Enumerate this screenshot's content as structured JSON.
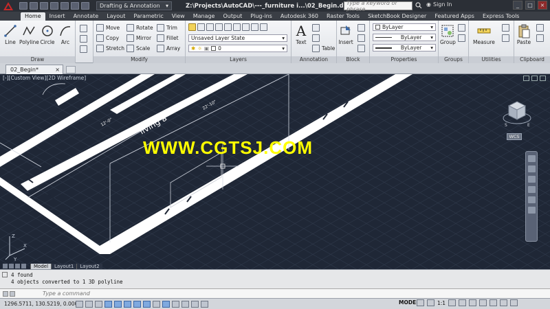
{
  "title_bar": {
    "workspace": "Drafting & Annotation",
    "document_path": "Z:\\Projects\\AutoCAD\\---_furniture i...\\02_Begin.dwg",
    "search_placeholder": "Type a keyword or phrase",
    "sign_in": "Sign In"
  },
  "ribbon_tabs": [
    "Home",
    "Insert",
    "Annotate",
    "Layout",
    "Parametric",
    "View",
    "Manage",
    "Output",
    "Plug-ins",
    "Autodesk 360",
    "Raster Tools",
    "SketchBook Designer",
    "Featured Apps",
    "Express Tools"
  ],
  "ribbon": {
    "draw": {
      "title": "Draw",
      "line": "Line",
      "polyline": "Polyline",
      "circle": "Circle",
      "arc": "Arc"
    },
    "modify": {
      "title": "Modify",
      "move": "Move",
      "rotate": "Rotate",
      "trim": "Trim",
      "copy": "Copy",
      "mirror": "Mirror",
      "fillet": "Fillet",
      "stretch": "Stretch",
      "scale": "Scale",
      "array": "Array"
    },
    "layers": {
      "title": "Layers",
      "layer_state": "Unsaved Layer State",
      "current_layer": "0"
    },
    "annotation": {
      "title": "Annotation",
      "text": "Text",
      "table": "Table"
    },
    "block": {
      "title": "Block",
      "insert": "Insert"
    },
    "properties": {
      "title": "Properties",
      "color": "ByLayer",
      "linetype": "ByLayer",
      "lineweight": "ByLayer"
    },
    "groups": {
      "title": "Groups",
      "group": "Group"
    },
    "utilities": {
      "title": "Utilities",
      "measure": "Measure"
    },
    "clipboard": {
      "title": "Clipboard",
      "paste": "Paste"
    }
  },
  "file_tab": "02_Begin*",
  "viewport": {
    "label": "[-][Custom View][2D Wireframe]",
    "watermark": "WWW.CGTSJ.COM",
    "room_label": "living a",
    "viewcube_wcs": "WCS",
    "viewcube_south": "S",
    "viewcube_east": "E"
  },
  "layout_tabs": [
    "Model",
    "Layout1",
    "Layout2"
  ],
  "command_history": [
    "4 found",
    "4 objects converted to 1 3D polyline"
  ],
  "command_placeholder": "Type a command",
  "status": {
    "coordinates": "1296.5711, 130.5219, 0.0000",
    "model": "MODEL",
    "scale": "1:1"
  },
  "colors": {
    "viewport_bg": "#1f2736",
    "grid": "#2d3749",
    "walls": "#ffffff",
    "watermark": "#ffff00",
    "title_bar": "#2b2f36"
  }
}
